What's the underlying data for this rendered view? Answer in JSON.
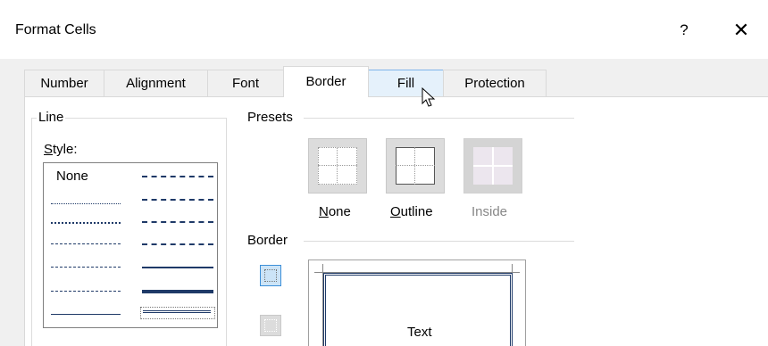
{
  "window": {
    "title": "Format Cells",
    "help_label": "?",
    "close_label": "✕"
  },
  "tabs": [
    {
      "label": "Number"
    },
    {
      "label": "Alignment"
    },
    {
      "label": "Font"
    },
    {
      "label": "Border",
      "active": true
    },
    {
      "label": "Fill",
      "hover": true
    },
    {
      "label": "Protection"
    }
  ],
  "line": {
    "group_label": "Line",
    "style_label_first": "S",
    "style_label_rest": "tyle:",
    "none_label": "None"
  },
  "presets": {
    "group_label": "Presets",
    "none": {
      "underlined": "N",
      "rest": "one"
    },
    "outline": {
      "underlined": "O",
      "rest": "utline"
    },
    "inside": {
      "label": "Inside"
    }
  },
  "border": {
    "group_label": "Border",
    "preview_text": "Text"
  },
  "colors": {
    "line_color": "#1f3a68",
    "hover_tab": "#e5f1fb",
    "accent": "#0078d7"
  }
}
